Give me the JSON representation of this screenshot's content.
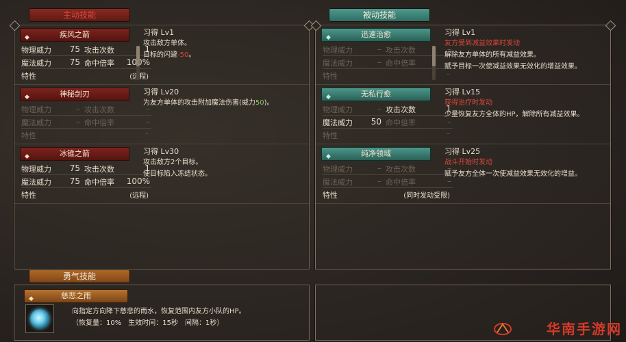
{
  "tabs": {
    "active": "主动技能",
    "passive": "被动技能",
    "courage": "勇气技能"
  },
  "active_skills": [
    {
      "name": "疾风之箭",
      "learn": "习得 Lv1",
      "desc": [
        "攻击敌方单体。",
        "目标的闪避"
      ],
      "desc_extra": "-50",
      "desc_end": "。",
      "phys_label": "物理威力",
      "phys_val": "75",
      "hits_label": "攻击次数",
      "hits_val": "1",
      "mag_label": "魔法威力",
      "mag_val": "75",
      "acc_label": "命中倍率",
      "acc_val": "100%",
      "trait_label": "特性",
      "trait_val": "(远程)"
    },
    {
      "name": "神秘剑刃",
      "learn": "习得 Lv20",
      "desc_line": "为友方单体的攻击附加魔法伤害(威力",
      "desc_num": "50",
      "desc_tail": ")。",
      "phys_label": "物理威力",
      "phys_val": "–",
      "hits_label": "攻击次数",
      "hits_val": "–",
      "mag_label": "魔法威力",
      "mag_val": "–",
      "acc_label": "命中倍率",
      "acc_val": "–",
      "trait_label": "特性",
      "trait_val": "–"
    },
    {
      "name": "冰锥之箭",
      "learn": "习得 Lv30",
      "desc": [
        "攻击敌方2个目标。",
        "使目标陷入冻结状态。"
      ],
      "phys_label": "物理威力",
      "phys_val": "75",
      "hits_label": "攻击次数",
      "hits_val": "1",
      "mag_label": "魔法威力",
      "mag_val": "75",
      "acc_label": "命中倍率",
      "acc_val": "100%",
      "trait_label": "特性",
      "trait_val": "(远程)"
    }
  ],
  "passive_skills": [
    {
      "name": "迅速治愈",
      "learn": "习得 Lv1",
      "trigger": "友方受到减益效果时发动",
      "desc": [
        "解除友方单体的所有减益效果。",
        "赋予目标一次使减益效果无效化的增益效果。"
      ],
      "phys_label": "物理威力",
      "phys_val": "–",
      "hits_label": "攻击次数",
      "hits_val": "–",
      "mag_label": "魔法威力",
      "mag_val": "–",
      "acc_label": "命中倍率",
      "acc_val": "–",
      "trait_label": "特性",
      "trait_val": "–"
    },
    {
      "name": "无私行愈",
      "learn": "习得 Lv15",
      "trigger": "获得治疗时发动",
      "desc": [
        "少量恢复友方全体的HP，解除所有减益效果。"
      ],
      "phys_label": "物理威力",
      "phys_val": "–",
      "hits_label": "攻击次数",
      "hits_val": "1",
      "mag_label": "魔法威力",
      "mag_val": "50",
      "acc_label": "命中倍率",
      "acc_val": "–",
      "trait_label": "特性",
      "trait_val": "–"
    },
    {
      "name": "纯净领域",
      "learn": "习得 Lv25",
      "trigger": "战斗开始时发动",
      "desc": [
        "赋予友方全体一次使减益效果无效化的增益。"
      ],
      "phys_label": "物理威力",
      "phys_val": "–",
      "hits_label": "攻击次数",
      "hits_val": "–",
      "mag_label": "魔法威力",
      "mag_val": "–",
      "acc_label": "命中倍率",
      "acc_val": "–",
      "trait_label": "特性",
      "trait_val": "(同时发动受限)"
    }
  ],
  "courage_skill": {
    "name": "慈悲之雨",
    "desc1": "向指定方向降下慈悲的雨水，恢复范围内友方小队的HP。",
    "desc2": "（恢复量：10%　生效时间：15秒　间隔：1秒）"
  },
  "watermark": "华南手游网",
  "colors": {
    "active_tab": "#8a2a22",
    "passive_tab": "#4f9c90",
    "courage_tab": "#b06a28",
    "warn_text": "#d9473a",
    "power_text": "#88c46a"
  }
}
